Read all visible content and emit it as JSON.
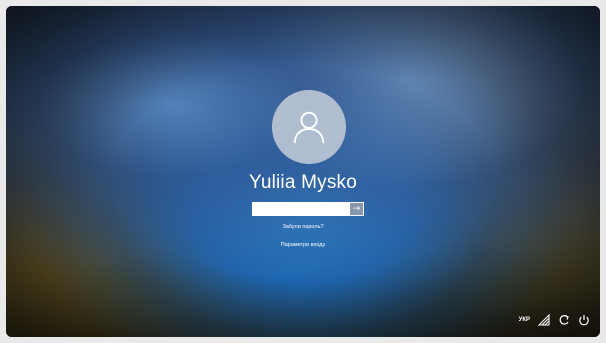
{
  "user": {
    "name": "Yuliia Mysko"
  },
  "login": {
    "password_placeholder": "",
    "submit_glyph": "→",
    "forgot_password_link": "Забули пароль?",
    "sign_in_options_link": "Параметри входу"
  },
  "tray": {
    "keyboard_language": "УКР",
    "icons": [
      "network-icon",
      "accessibility-icon",
      "power-icon"
    ]
  },
  "colors": {
    "text": "#ffffff",
    "avatar_bg": "#d2d7de",
    "lake_blue": "#2a8cdc"
  }
}
